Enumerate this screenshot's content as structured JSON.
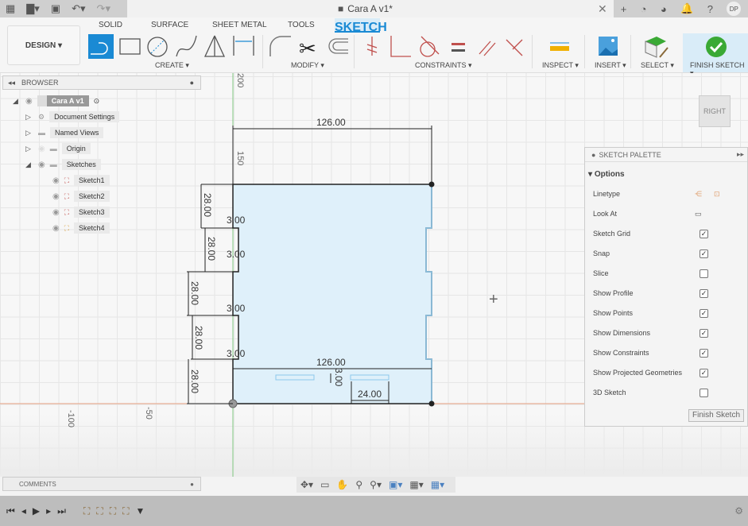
{
  "app": {
    "title": "Cara A v1*",
    "user_initials": "DP"
  },
  "workspace": {
    "label": "DESIGN"
  },
  "tabs": [
    {
      "label": "SOLID"
    },
    {
      "label": "SURFACE"
    },
    {
      "label": "SHEET METAL"
    },
    {
      "label": "TOOLS"
    },
    {
      "label": "SKETCH",
      "active": true
    }
  ],
  "groups": {
    "create": "CREATE ▾",
    "modify": "MODIFY ▾",
    "constraints": "CONSTRAINTS ▾",
    "inspect": "INSPECT ▾",
    "insert": "INSERT ▾",
    "select": "SELECT ▾",
    "finish": "FINISH SKETCH ▾"
  },
  "browser": {
    "title": "BROWSER",
    "root": "Cara A v1",
    "items": [
      {
        "label": "Document Settings"
      },
      {
        "label": "Named Views"
      },
      {
        "label": "Origin"
      },
      {
        "label": "Sketches"
      }
    ],
    "sketches": [
      {
        "label": "Sketch1"
      },
      {
        "label": "Sketch2"
      },
      {
        "label": "Sketch3"
      },
      {
        "label": "Sketch4"
      }
    ]
  },
  "viewcube": {
    "face": "RIGHT"
  },
  "ruler": {
    "v200": "200",
    "v150": "150",
    "h_neg100": "-100",
    "h_neg50": "-50"
  },
  "dimensions": {
    "top_width": "126.00",
    "inner_width": "126.00",
    "seg1": "28.00",
    "seg2": "28.00",
    "seg3": "28.00",
    "seg4": "28.00",
    "seg5": "28.00",
    "notch1": "3.00",
    "notch2": "3.00",
    "notch3": "3.00",
    "notch4": "3.00",
    "slot_height": "3.00",
    "slot_width": "24.00"
  },
  "palette": {
    "title": "SKETCH PALETTE",
    "section": "Options",
    "linetype": "Linetype",
    "look_at": "Look At",
    "options": [
      {
        "label": "Sketch Grid",
        "checked": true
      },
      {
        "label": "Snap",
        "checked": true
      },
      {
        "label": "Slice",
        "checked": false
      },
      {
        "label": "Show Profile",
        "checked": true
      },
      {
        "label": "Show Points",
        "checked": true
      },
      {
        "label": "Show Dimensions",
        "checked": true
      },
      {
        "label": "Show Constraints",
        "checked": true
      },
      {
        "label": "Show Projected Geometries",
        "checked": true
      },
      {
        "label": "3D Sketch",
        "checked": false
      }
    ],
    "finish": "Finish Sketch"
  },
  "comments": {
    "title": "COMMENTS"
  },
  "colors": {
    "accent": "#1a8ad4",
    "finish_green": "#3aa935",
    "profile_fill": "#dff0fa",
    "constraint_red": "#c0504d"
  }
}
